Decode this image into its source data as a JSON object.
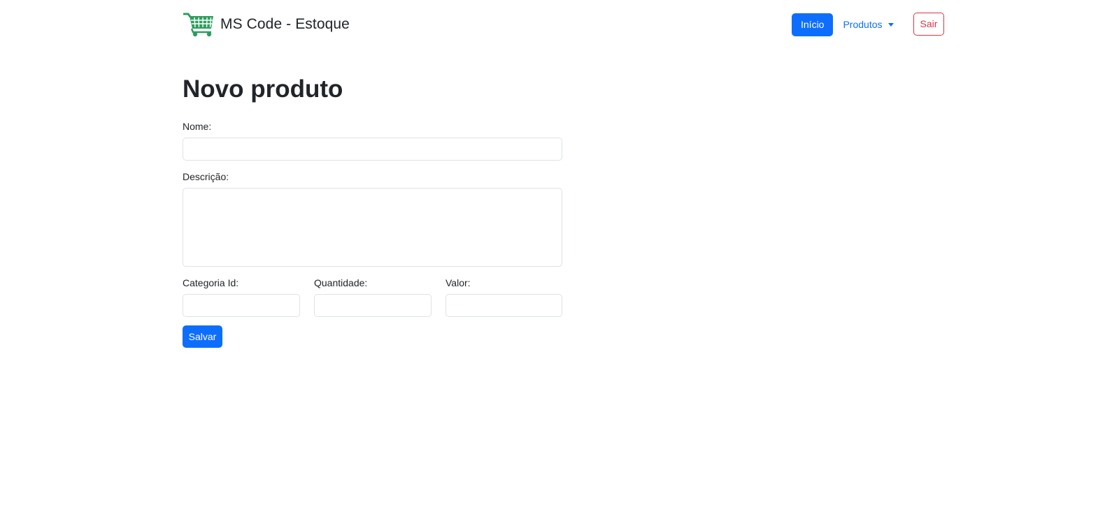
{
  "navbar": {
    "brand_text": "MS Code - Estoque",
    "brand_icon": "shopping-cart-icon",
    "brand_icon_color": "#2e9e5e",
    "links": {
      "inicio": "Início",
      "produtos": "Produtos",
      "sair": "Sair"
    }
  },
  "page": {
    "title": "Novo produto"
  },
  "form": {
    "nome_label": "Nome:",
    "nome_value": "",
    "descricao_label": "Descrição:",
    "descricao_value": "",
    "categoria_label": "Categoria Id:",
    "categoria_value": "",
    "quantidade_label": "Quantidade:",
    "quantidade_value": "",
    "valor_label": "Valor:",
    "valor_value": "",
    "submit_label": "Salvar"
  },
  "colors": {
    "primary": "#0d6efd",
    "danger": "#dc3545",
    "border": "#dee2e6"
  }
}
